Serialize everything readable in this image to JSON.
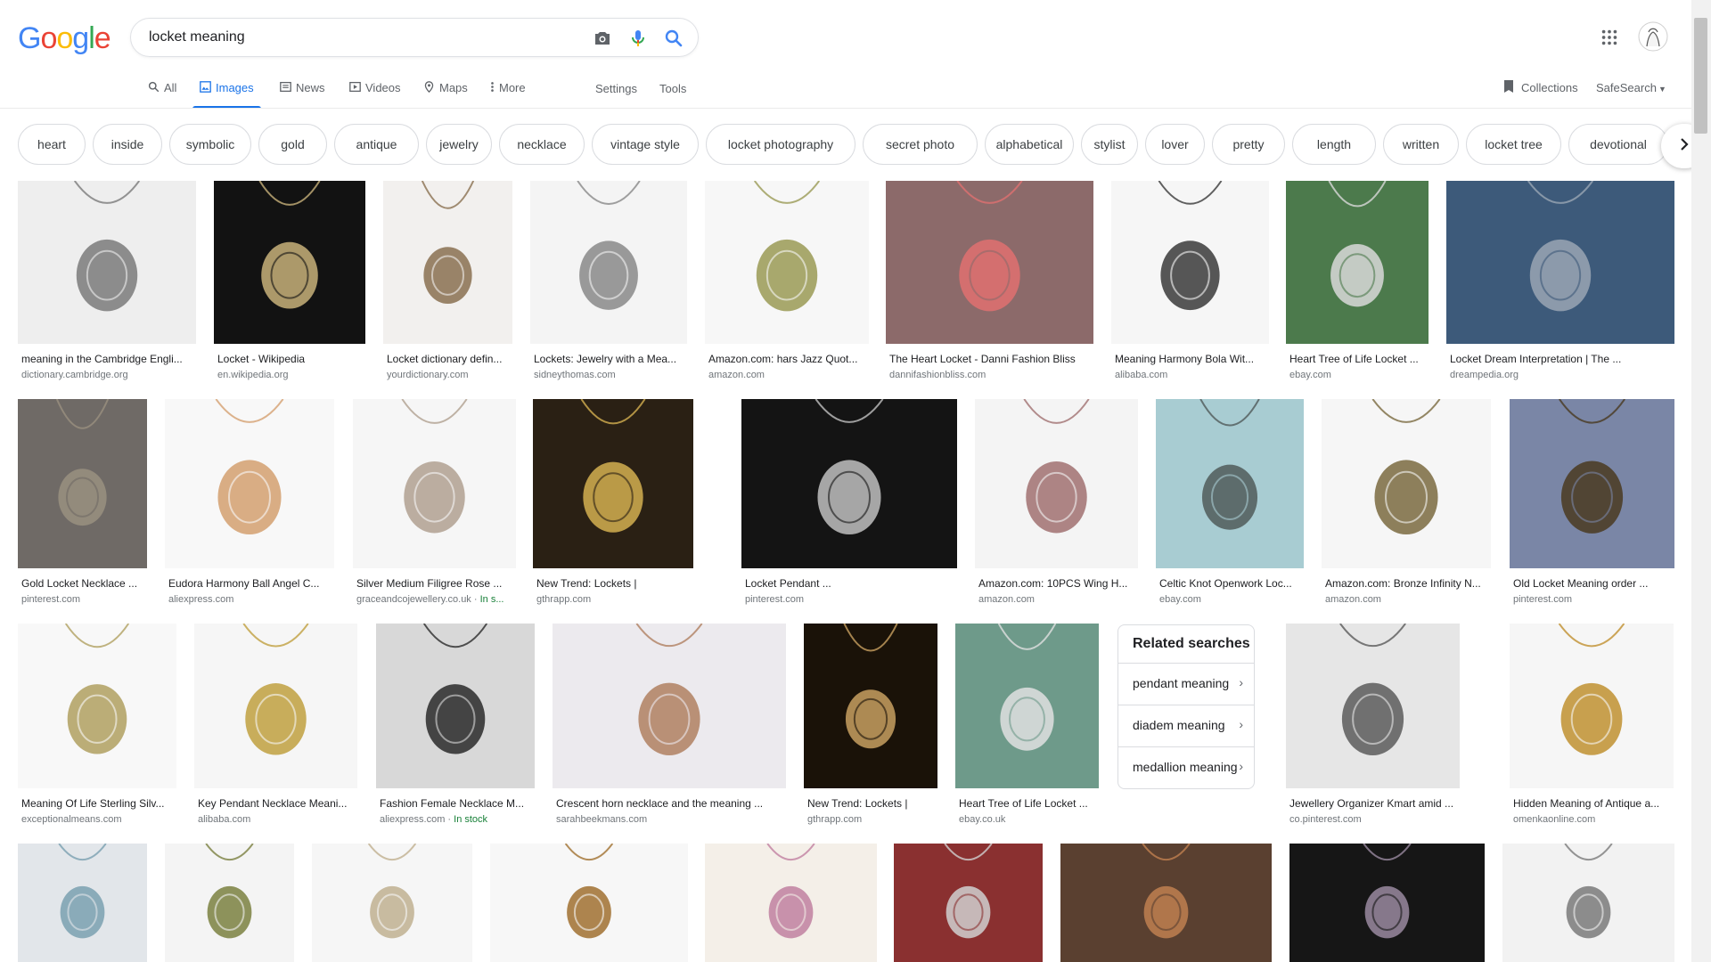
{
  "logo": {
    "letters": [
      "G",
      "o",
      "o",
      "g",
      "l",
      "e"
    ],
    "colors": [
      "#4285F4",
      "#EA4335",
      "#FBBC05",
      "#4285F4",
      "#34A853",
      "#EA4335"
    ]
  },
  "search": {
    "query": "locket meaning"
  },
  "header": {
    "apps_icon": "apps-grid-icon",
    "avatar_icon": "account-avatar"
  },
  "tabs": [
    {
      "label": "All",
      "icon": "search-icon"
    },
    {
      "label": "Images",
      "icon": "image-icon",
      "active": true
    },
    {
      "label": "News",
      "icon": "news-icon"
    },
    {
      "label": "Videos",
      "icon": "video-icon"
    },
    {
      "label": "Maps",
      "icon": "map-icon"
    },
    {
      "label": "More",
      "icon": "more-vertical-icon"
    }
  ],
  "tools": {
    "settings": "Settings",
    "tools": "Tools",
    "collections": "Collections",
    "safesearch": "SafeSearch"
  },
  "chips": [
    "heart",
    "inside",
    "symbolic",
    "gold",
    "antique",
    "jewelry",
    "necklace",
    "vintage style",
    "locket photography",
    "secret photo",
    "alphabetical",
    "stylist",
    "lover",
    "pretty",
    "length",
    "written",
    "locket tree",
    "devotional"
  ],
  "rows": [
    [
      {
        "title": "meaning in the Cambridge Engli...",
        "source": "dictionary.cambridge.org",
        "bg": "#eeeeee",
        "fg": "#7a7a7a"
      },
      {
        "title": "Locket - Wikipedia",
        "source": "en.wikipedia.org",
        "bg": "#121212",
        "fg": "#c8b27a"
      },
      {
        "title": "Locket dictionary defin...",
        "source": "yourdictionary.com",
        "bg": "#f2f0ee",
        "fg": "#8a7050"
      },
      {
        "title": "Lockets: Jewelry with a Mea...",
        "source": "sidneythomas.com",
        "bg": "#f4f4f4",
        "fg": "#888888"
      },
      {
        "title": "Amazon.com: hars Jazz Quot...",
        "source": "amazon.com",
        "bg": "#f7f7f7",
        "fg": "#9a9a55"
      },
      {
        "title": "The Heart Locket - Danni Fashion Bliss",
        "source": "dannifashionbliss.com",
        "bg": "#8c6a6a",
        "fg": "#e07070"
      },
      {
        "title": "Meaning Harmony Bola Wit...",
        "source": "alibaba.com",
        "bg": "#f6f6f6",
        "fg": "#3a3a3a"
      },
      {
        "title": "Heart Tree of Life Locket ...",
        "source": "ebay.com",
        "bg": "#4c7a4c",
        "fg": "#d9d9d9"
      },
      {
        "title": "Locket Dream Interpretation | The ...",
        "source": "dreampedia.org",
        "bg": "#3d5a7a",
        "fg": "#9aa6b4"
      }
    ],
    [
      {
        "title": "Gold Locket Necklace ...",
        "source": "pinterest.com",
        "bg": "#6f6a66",
        "fg": "#9a9080"
      },
      {
        "title": "Eudora Harmony Ball Angel C...",
        "source": "aliexpress.com",
        "bg": "#f8f8f8",
        "fg": "#d4a070"
      },
      {
        "title": "Silver Medium Filigree Rose ...",
        "source": "graceandcojewellery.co.uk",
        "stock": "In s...",
        "bg": "#f6f6f6",
        "fg": "#b0a090"
      },
      {
        "title": "New Trend: Lockets |",
        "source": "gthrapp.com",
        "bg": "#2a2014",
        "fg": "#d4b050"
      },
      {
        "title": "Locket Pendant ...",
        "source": "pinterest.com",
        "bg": "#141414",
        "fg": "#c0c0c0"
      },
      {
        "title": "Amazon.com: 10PCS Wing H...",
        "source": "amazon.com",
        "bg": "#f4f4f4",
        "fg": "#a07070"
      },
      {
        "title": "Celtic Knot Openwork Loc...",
        "source": "ebay.com",
        "bg": "#a8ccd2",
        "fg": "#505a5a"
      },
      {
        "title": "Amazon.com: Bronze Infinity N...",
        "source": "amazon.com",
        "bg": "#f6f6f6",
        "fg": "#7a6a40"
      },
      {
        "title": "Old Locket Meaning order ...",
        "source": "pinterest.com",
        "bg": "#7a86a6",
        "fg": "#4a3a20"
      }
    ],
    [
      {
        "title": "Meaning Of Life Sterling Silv...",
        "source": "exceptionalmeans.com",
        "bg": "#f8f8f8",
        "fg": "#b0a060"
      },
      {
        "title": "Key Pendant Necklace Meani...",
        "source": "alibaba.com",
        "bg": "#f6f6f6",
        "fg": "#c0a040"
      },
      {
        "title": "Fashion Female Necklace M...",
        "source": "aliexpress.com",
        "stock": "In stock",
        "bg": "#d8d8d8",
        "fg": "#2a2a2a"
      },
      {
        "title": "Crescent horn necklace and the meaning ...",
        "source": "sarahbeekmans.com",
        "bg": "#eceaee",
        "fg": "#b08060"
      },
      {
        "title": "New Trend: Lockets |",
        "source": "gthrapp.com",
        "bg": "#1a1208",
        "fg": "#c8a060"
      },
      {
        "title": "Heart Tree of Life Locket ...",
        "source": "ebay.co.uk",
        "bg": "#6e9a8a",
        "fg": "#e0e0e0"
      },
      {
        "title": "Jewellery Organizer Kmart amid ...",
        "source": "co.pinterest.com",
        "bg": "#e6e6e6",
        "fg": "#5a5a5a"
      },
      {
        "title": "Hidden Meaning of Antique a...",
        "source": "omenkaonline.com",
        "bg": "#f6f6f6",
        "fg": "#c09030"
      }
    ],
    [
      {
        "title": "",
        "source": "",
        "bg": "#e2e6ea",
        "fg": "#7aa0b0"
      },
      {
        "title": "",
        "source": "",
        "bg": "#f4f4f4",
        "fg": "#7a8040"
      },
      {
        "title": "",
        "source": "",
        "bg": "#f6f6f6",
        "fg": "#c0b090"
      },
      {
        "title": "",
        "source": "",
        "bg": "#f7f7f7",
        "fg": "#a07030"
      },
      {
        "title": "",
        "source": "",
        "bg": "#f4efe8",
        "fg": "#c080a0"
      },
      {
        "title": "",
        "source": "",
        "bg": "#8a3030",
        "fg": "#d0d0d0"
      },
      {
        "title": "",
        "source": "",
        "bg": "#5a4030",
        "fg": "#c08050"
      },
      {
        "title": "",
        "source": "",
        "bg": "#161616",
        "fg": "#9a8aa0"
      },
      {
        "title": "",
        "source": "",
        "bg": "#f2f2f2",
        "fg": "#7a7a7a"
      }
    ]
  ],
  "related": {
    "heading": "Related searches",
    "items": [
      "pendant meaning",
      "diadem meaning",
      "medallion meaning"
    ]
  }
}
